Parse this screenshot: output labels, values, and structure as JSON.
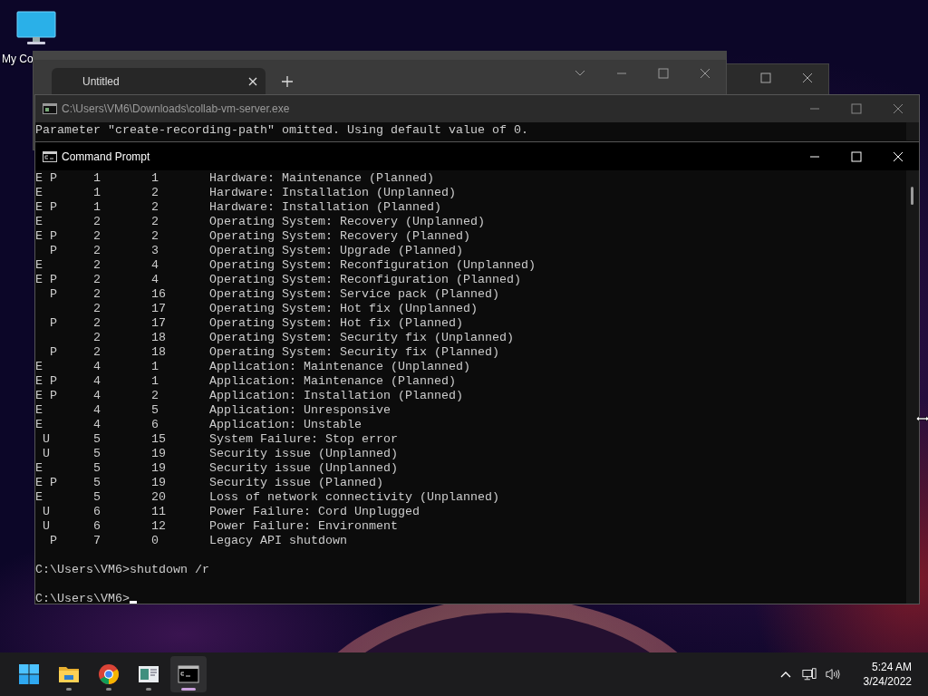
{
  "desktop": {
    "icons": [
      {
        "label": "My Co"
      }
    ]
  },
  "notepad": {
    "tabs": [
      {
        "label": "Untitled",
        "selected": true
      }
    ]
  },
  "server_console": {
    "title": "C:\\Users\\VM6\\Downloads\\collab-vm-server.exe",
    "lines": [
      "Parameter \"create-recording-path\" omitted. Using default value of 0."
    ]
  },
  "command_prompt": {
    "title": "Command Prompt",
    "lines": [
      "E P     1       1       Hardware: Maintenance (Planned)",
      "E       1       2       Hardware: Installation (Unplanned)",
      "E P     1       2       Hardware: Installation (Planned)",
      "E       2       2       Operating System: Recovery (Unplanned)",
      "E P     2       2       Operating System: Recovery (Planned)",
      "  P     2       3       Operating System: Upgrade (Planned)",
      "E       2       4       Operating System: Reconfiguration (Unplanned)",
      "E P     2       4       Operating System: Reconfiguration (Planned)",
      "  P     2       16      Operating System: Service pack (Planned)",
      "        2       17      Operating System: Hot fix (Unplanned)",
      "  P     2       17      Operating System: Hot fix (Planned)",
      "        2       18      Operating System: Security fix (Unplanned)",
      "  P     2       18      Operating System: Security fix (Planned)",
      "E       4       1       Application: Maintenance (Unplanned)",
      "E P     4       1       Application: Maintenance (Planned)",
      "E P     4       2       Application: Installation (Planned)",
      "E       4       5       Application: Unresponsive",
      "E       4       6       Application: Unstable",
      " U      5       15      System Failure: Stop error",
      " U      5       19      Security issue (Unplanned)",
      "E       5       19      Security issue (Unplanned)",
      "E P     5       19      Security issue (Planned)",
      "E       5       20      Loss of network connectivity (Unplanned)",
      " U      6       11      Power Failure: Cord Unplugged",
      " U      6       12      Power Failure: Environment",
      "  P     7       0       Legacy API shutdown"
    ],
    "commands": [
      {
        "prompt": "C:\\Users\\VM6>",
        "input": "shutdown /r"
      }
    ],
    "current_prompt": "C:\\Users\\VM6>"
  },
  "taskbar": {
    "apps": [
      {
        "kind": "start",
        "running": false,
        "selected": false
      },
      {
        "kind": "folder",
        "running": true,
        "selected": false
      },
      {
        "kind": "browser",
        "running": true,
        "selected": false
      },
      {
        "kind": "window",
        "running": true,
        "selected": false
      },
      {
        "kind": "terminal",
        "running": true,
        "selected": true
      }
    ],
    "clock": {
      "time": "5:24 AM",
      "date": "3/24/2022"
    }
  }
}
